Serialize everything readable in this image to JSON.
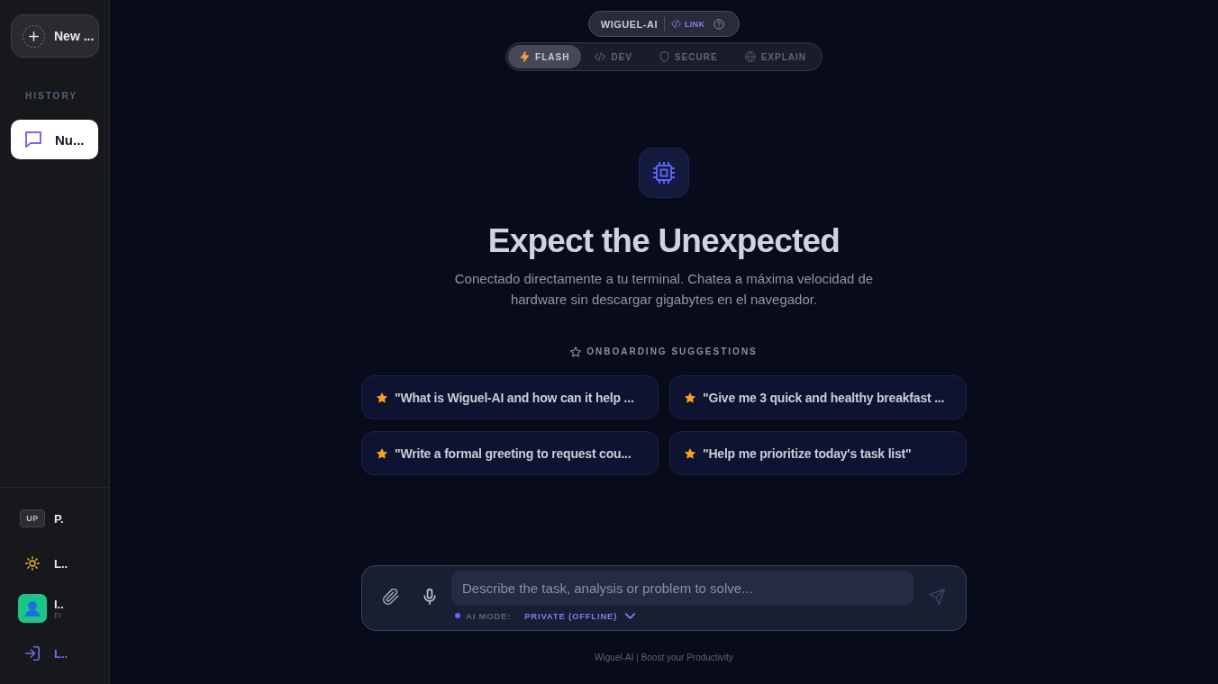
{
  "sidebar": {
    "new_chat_button": {
      "label": "New ..."
    },
    "history_heading": "HISTORY",
    "history": [
      {
        "title": "Nu...",
        "selected": true
      }
    ],
    "footer_items": [
      {
        "kind": "badge",
        "badge": "UP",
        "label": "P."
      },
      {
        "kind": "theme",
        "label": "L.."
      },
      {
        "kind": "profile",
        "label": "I..",
        "sublabel": "Fr"
      },
      {
        "kind": "signin",
        "label": "L.."
      }
    ]
  },
  "header": {
    "brand": "WIGUEL-AI",
    "link": "LINK",
    "modes": [
      {
        "kind": "flash",
        "label": "FLASH",
        "selected": true
      },
      {
        "kind": "dev",
        "label": "DEV",
        "selected": false
      },
      {
        "kind": "secure",
        "label": "SECURE",
        "selected": false
      },
      {
        "kind": "explain",
        "label": "EXPLAIN",
        "selected": false
      }
    ]
  },
  "hero": {
    "title": "Expect the Unexpected",
    "subtitle": "Conectado directamente a tu terminal. Chatea a máxima velocidad de hardware sin descargar gigabytes en el navegador.",
    "suggestions_heading": "ONBOARDING SUGGESTIONS",
    "suggestions": [
      "\"What is Wiguel-AI and how can it help ...",
      "\"Give me 3 quick and healthy breakfast ...",
      "\"Write a formal greeting to request cou...",
      "\"Help me prioritize today's task list\""
    ]
  },
  "composer": {
    "placeholder": "Describe the task, analysis or problem to solve...",
    "ai_mode_label": "AI MODE:",
    "ai_mode_value": "PRIVATE (OFFLINE)",
    "send_disabled": true
  },
  "footer": "Wiguel-AI | Boost your Productivity"
}
